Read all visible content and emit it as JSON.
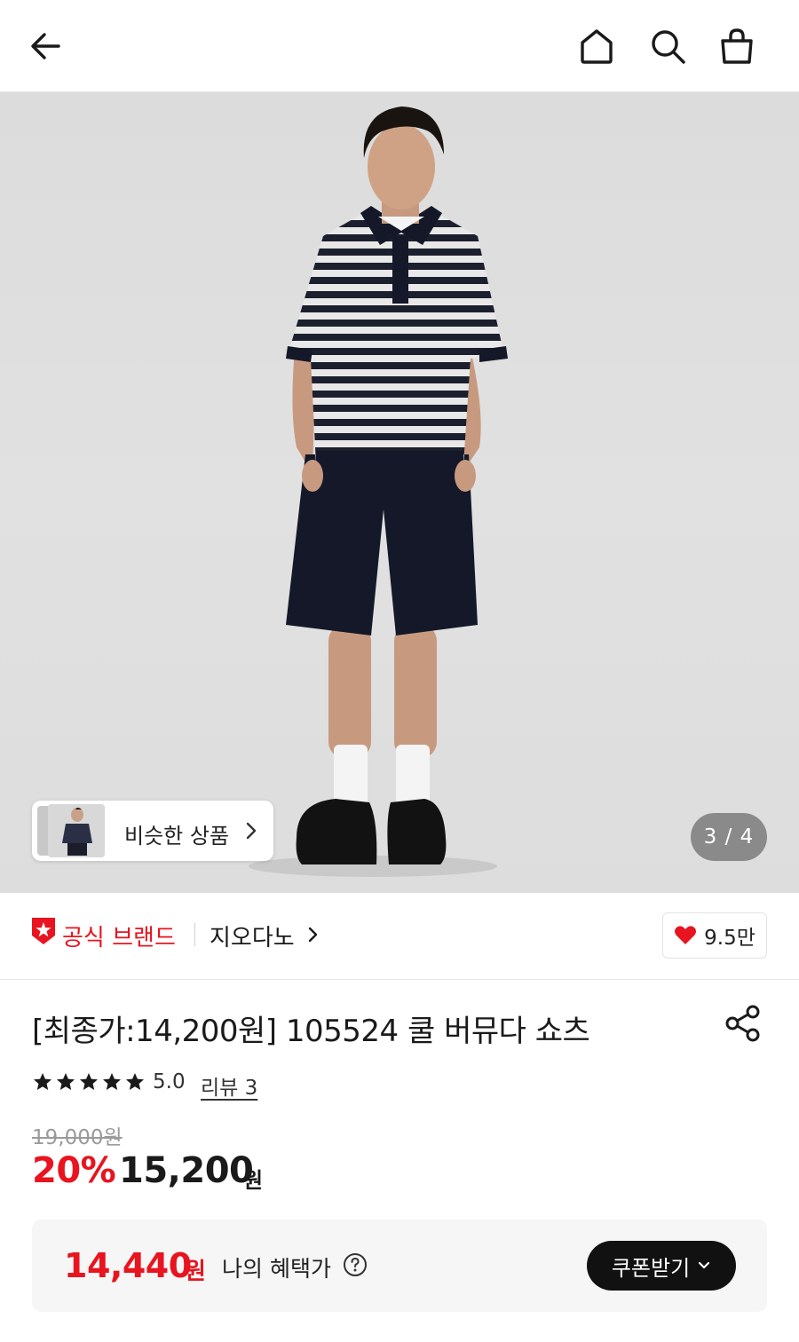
{
  "header": {
    "icons": [
      "back-arrow-icon",
      "home-icon",
      "search-icon",
      "shopping-bag-icon"
    ]
  },
  "gallery": {
    "similar_label": "비슷한 상품",
    "counter": "3 / 4"
  },
  "brand": {
    "badge_label": "공식 브랜드",
    "name": "지오다노",
    "likes": "9.5만"
  },
  "product": {
    "title": "[최종가:14,200원] 105524 쿨 버뮤다 쇼츠",
    "rating": "5.0",
    "stars": 5,
    "review_link": "리뷰 3",
    "original_price": "19,000원",
    "discount": "20%",
    "price": "15,200",
    "price_unit": "원"
  },
  "benefit": {
    "price": "14,440",
    "unit": "원",
    "label": "나의 혜택가",
    "coupon_button": "쿠폰받기"
  },
  "colors": {
    "accent_red": "#e8141f",
    "dark": "#111111",
    "panel_bg": "#f6f6f6"
  }
}
